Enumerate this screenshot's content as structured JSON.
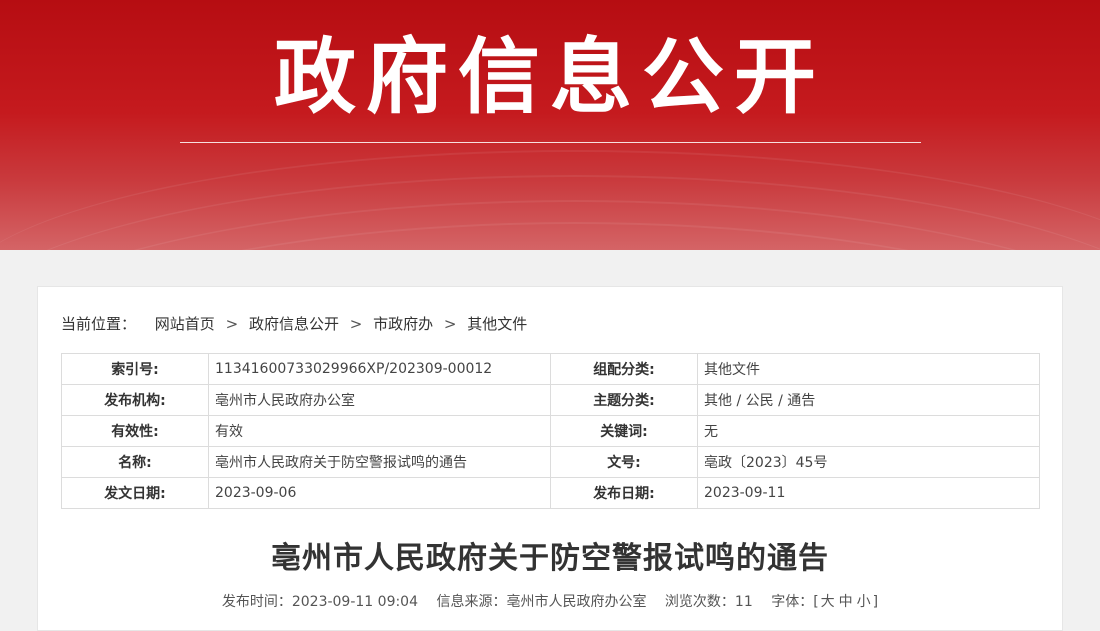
{
  "banner": {
    "title": "政府信息公开"
  },
  "breadcrumb": {
    "label": "当前位置：",
    "items": [
      "网站首页",
      "政府信息公开",
      "市政府办",
      "其他文件"
    ],
    "separator": ">"
  },
  "meta_table": {
    "rows": [
      {
        "k1": "索引号:",
        "v1": "11341600733029966XP/202309-00012",
        "k2": "组配分类:",
        "v2": "其他文件"
      },
      {
        "k1": "发布机构:",
        "v1": "亳州市人民政府办公室",
        "k2": "主题分类:",
        "v2": "其他 / 公民 / 通告"
      },
      {
        "k1": "有效性:",
        "v1": "有效",
        "k2": "关键词:",
        "v2": "无"
      },
      {
        "k1": "名称:",
        "v1": "亳州市人民政府关于防空警报试鸣的通告",
        "k2": "文号:",
        "v2": "亳政〔2023〕45号"
      },
      {
        "k1": "发文日期:",
        "v1": "2023-09-06",
        "k2": "发布日期:",
        "v2": "2023-09-11"
      }
    ]
  },
  "article": {
    "title": "亳州市人民政府关于防空警报试鸣的通告",
    "publish_time_label": "发布时间：",
    "publish_time": "2023-09-11 09:04",
    "source_label": "信息来源：",
    "source": "亳州市人民政府办公室",
    "views_label": "浏览次数：",
    "views": "11",
    "font_label": "字体：",
    "font_open": "[",
    "font_large": "大",
    "font_medium": "中",
    "font_small": "小",
    "font_close": "]"
  },
  "colors": {
    "banner_red": "#b60d12",
    "background": "#f1f1f1"
  }
}
